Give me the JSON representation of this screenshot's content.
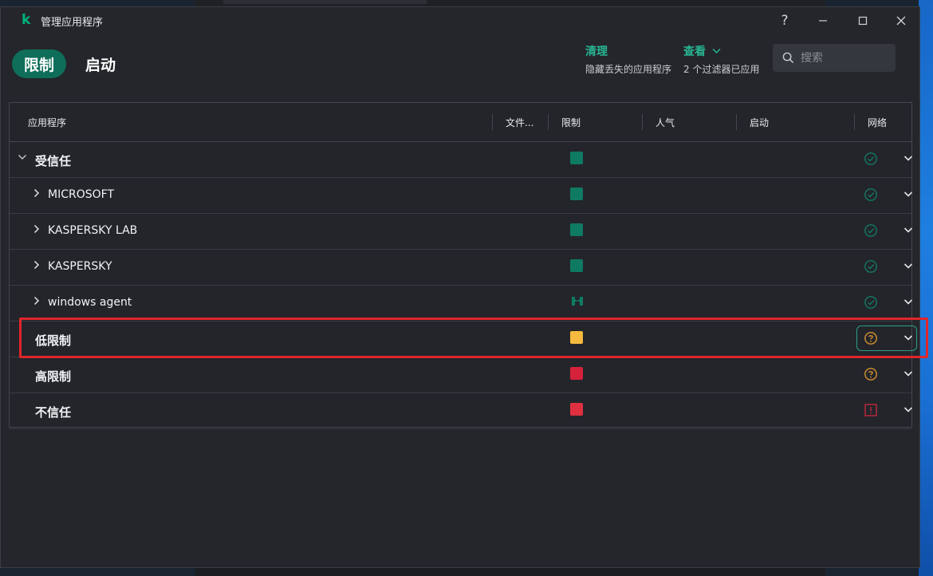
{
  "window": {
    "title": "管理应用程序",
    "logo": "k"
  },
  "titlebar": {
    "help": "?"
  },
  "tabs": [
    {
      "label": "限制",
      "active": true
    },
    {
      "label": "启动",
      "active": false
    }
  ],
  "actions": {
    "clean": {
      "title": "清理",
      "subtitle": "隐藏丢失的应用程序"
    },
    "view": {
      "title": "查看",
      "subtitle": "2 个过滤器已应用"
    }
  },
  "search": {
    "placeholder": "搜索",
    "value": ""
  },
  "table": {
    "headers": [
      "应用程序",
      "文件...",
      "限制",
      "人气",
      "启动",
      "网络"
    ],
    "rows": [
      {
        "label": "受信任",
        "level": 0,
        "expanded": true,
        "restriction_color": "#0f7a62",
        "network": "check-circle-icon"
      },
      {
        "label": "MICROSOFT",
        "level": 1,
        "expanded": false,
        "restriction_color": "#0f7a62",
        "network": "check-circle-icon"
      },
      {
        "label": "KASPERSKY LAB",
        "level": 1,
        "expanded": false,
        "restriction_color": "#0f7a62",
        "network": "check-circle-icon"
      },
      {
        "label": "KASPERSKY",
        "level": 1,
        "expanded": false,
        "restriction_color": "#0f7a62",
        "network": "check-circle-icon"
      },
      {
        "label": "windows agent",
        "level": 1,
        "expanded": false,
        "restriction_color": "#0f7a62",
        "restriction_icon": "user-shield-icon",
        "network": "check-circle-icon"
      },
      {
        "label": "低限制",
        "level": 0,
        "expanded": null,
        "restriction_color": "#f5b93f",
        "network": "question-circle-icon",
        "highlighted": true
      },
      {
        "label": "高限制",
        "level": 0,
        "expanded": null,
        "restriction_color": "#d6213a",
        "network": "question-circle-icon"
      },
      {
        "label": "不信任",
        "level": 0,
        "expanded": null,
        "restriction_color": "#e03040",
        "network": "alert-square-icon"
      }
    ]
  },
  "colors": {
    "accent": "#0e6e5a",
    "accent_text": "#27b592",
    "check": "#137a5f",
    "question": "#c98a2e",
    "alert": "#b8283a",
    "highlight_border": "#e0262a"
  }
}
